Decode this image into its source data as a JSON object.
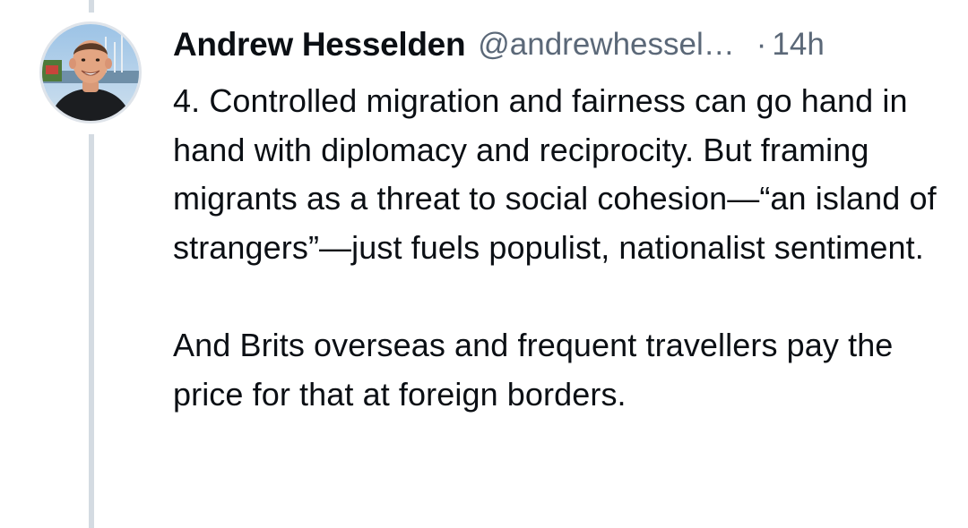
{
  "post": {
    "author": {
      "display_name": "Andrew Hesselden",
      "handle": "@andrewhessel…",
      "avatar_icon": "profile-photo-icon"
    },
    "separator": "·",
    "timestamp": "14h",
    "body": {
      "paragraphs": [
        "4. Controlled migration and fairness can go hand in hand with diplomacy and reciprocity. But framing migrants as a threat to social cohesion—“an island of strangers”—just fuels populist, nationalist sentiment.",
        "And Brits overseas and frequent travellers pay the price for that at foreign borders."
      ]
    }
  },
  "colors": {
    "text_primary": "#0b0f14",
    "text_secondary": "#5b6878",
    "thread_line": "#d4dbe2",
    "background": "#ffffff"
  }
}
